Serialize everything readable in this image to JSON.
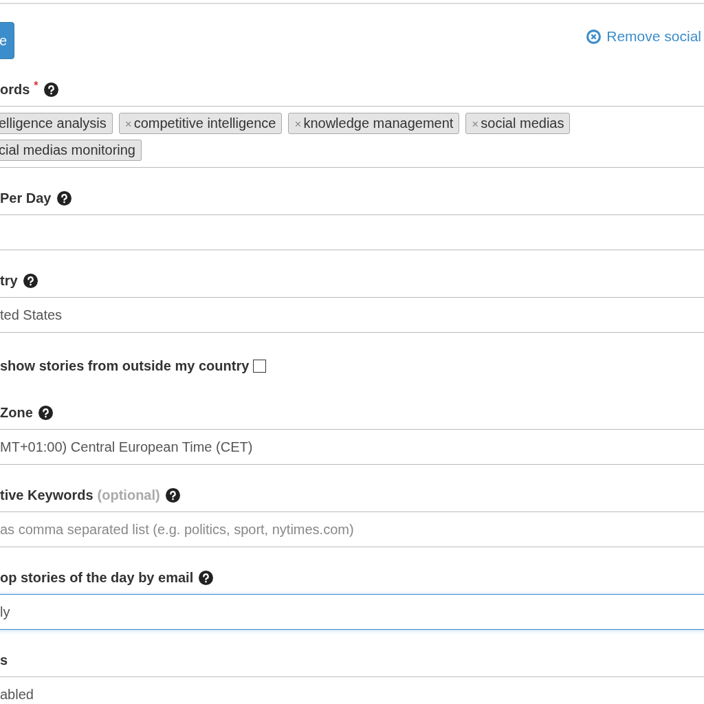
{
  "toolbar": {
    "button": "e",
    "remove_link": "Remove social"
  },
  "fields": [
    {
      "kind": "tags",
      "label": "ords",
      "required_mark": "*",
      "help": true,
      "tags": [
        {
          "text": "elligence analysis"
        },
        {
          "text": "competitive intelligence",
          "remove": "×"
        },
        {
          "text": "knowledge management",
          "remove": "×"
        },
        {
          "text": "social medias",
          "remove": "×"
        },
        {
          "text": "cial medias monitoring"
        }
      ]
    },
    {
      "kind": "input",
      "label": "Per Day",
      "help": true
    },
    {
      "kind": "input",
      "label": "try",
      "help": true,
      "value": "ted States"
    },
    {
      "kind": "checkbox",
      "label": "show stories from outside my country",
      "checked": false
    },
    {
      "kind": "input",
      "label": "Zone",
      "help": true,
      "value": "MT+01:00) Central European Time (CET)"
    },
    {
      "kind": "input",
      "label": "tive Keywords",
      "note": "(optional)",
      "help": true,
      "placeholder": "as comma separated list (e.g. politics, sport, nytimes.com)"
    },
    {
      "kind": "input",
      "label": "op stories of the day by email",
      "help": true,
      "value": "ly",
      "focused": true
    },
    {
      "kind": "input",
      "label": "s",
      "value": "abled"
    }
  ]
}
